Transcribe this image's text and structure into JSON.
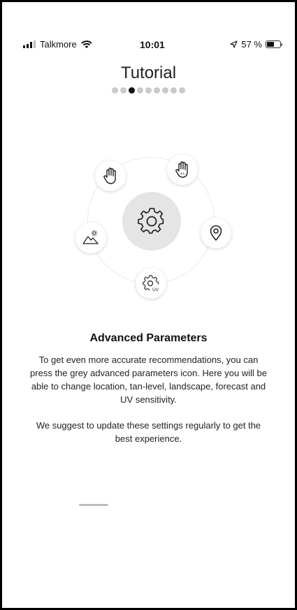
{
  "status_bar": {
    "carrier": "Talkmore",
    "time": "10:01",
    "battery": "57 %",
    "battery_level": 0.57
  },
  "page": {
    "title": "Tutorial",
    "dots_total": 9,
    "active_dot": 3
  },
  "wheel": {
    "center": "gear-icon",
    "nodes": [
      "hand-icon",
      "hand-plus-minus-icon",
      "location-pin-icon",
      "uv-gear-icon",
      "landscape-icon"
    ]
  },
  "content": {
    "heading": "Advanced Parameters",
    "paragraph1": "To get even more accurate recommendations, you can press the grey advanced parameters icon. Here you will be able to change location, tan-level, landscape, forecast and UV sensitivity.",
    "paragraph2": "We suggest to update these settings regularly to get the best experience."
  }
}
